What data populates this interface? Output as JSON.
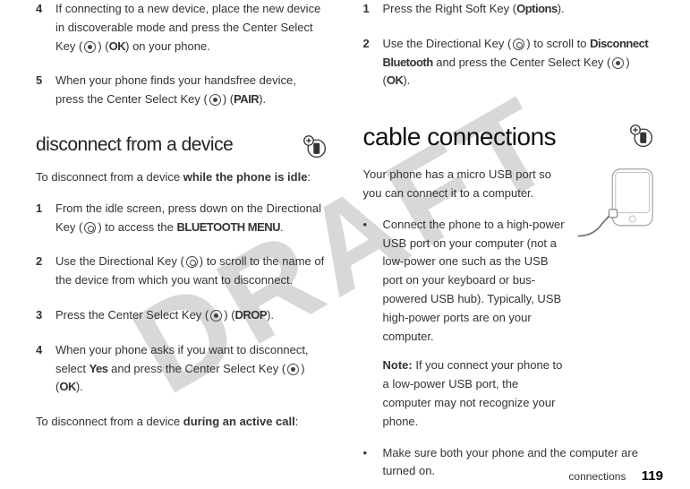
{
  "watermark": "DRAFT",
  "left": {
    "step4": {
      "num": "4",
      "text_a": "If connecting to a new device, place the new device in discoverable mode and press the Center Select Key (",
      "text_b": ") (",
      "ok": "OK",
      "text_c": ") on your phone."
    },
    "step5": {
      "num": "5",
      "text_a": "When your phone finds your handsfree device, press the Center Select Key (",
      "text_b": ") (",
      "pair": "PAIR",
      "text_c": ")."
    },
    "heading2": "disconnect from a device",
    "idle_intro_a": "To disconnect from a device ",
    "idle_intro_b": "while the phone is idle",
    "idle_intro_c": ":",
    "step1": {
      "num": "1",
      "text_a": "From the idle screen, press down on the Directional Key (",
      "text_b": ") to access the ",
      "menu": "BLUETOOTH MENU",
      "text_c": "."
    },
    "step2": {
      "num": "2",
      "text_a": "Use the Directional Key (",
      "text_b": ") to scroll to the name of the device from which you want to disconnect."
    },
    "step3": {
      "num": "3",
      "text_a": "Press the Center Select Key (",
      "text_b": ") (",
      "drop": "DROP",
      "text_c": ")."
    },
    "step4b": {
      "num": "4",
      "text_a": "When your phone asks if you want to disconnect, select ",
      "yes": "Yes",
      "text_b": " and press the Center Select Key (",
      "text_c": ") (",
      "ok": "OK",
      "text_d": ")."
    },
    "active_intro_a": "To disconnect from a device ",
    "active_intro_b": "during an active call",
    "active_intro_c": ":"
  },
  "right": {
    "step1": {
      "num": "1",
      "text_a": "Press the Right Soft Key (",
      "options": "Options",
      "text_b": ")."
    },
    "step2": {
      "num": "2",
      "text_a": "Use the Directional Key (",
      "text_b": ") to scroll to ",
      "disconnect": "Disconnect Bluetooth",
      "text_c": " and press the Center Select Key (",
      "text_d": ") (",
      "ok": "OK",
      "text_e": ")."
    },
    "heading1": "cable connections",
    "usb_intro": "Your phone has a micro USB port so you can connect it to a computer.",
    "bullet1_a": "Connect the phone to a high-power USB port on your computer (not a low-power one such as the USB port on your keyboard or bus-powered USB hub). Typically, USB high-power ports are on your computer.",
    "note_label": "Note:",
    "note_text": " If you connect your phone to a low-power USB port, the computer may not recognize your phone.",
    "bullet2": "Make sure both your phone and the computer are turned on."
  },
  "footer": {
    "label": "connections",
    "page": "119"
  }
}
